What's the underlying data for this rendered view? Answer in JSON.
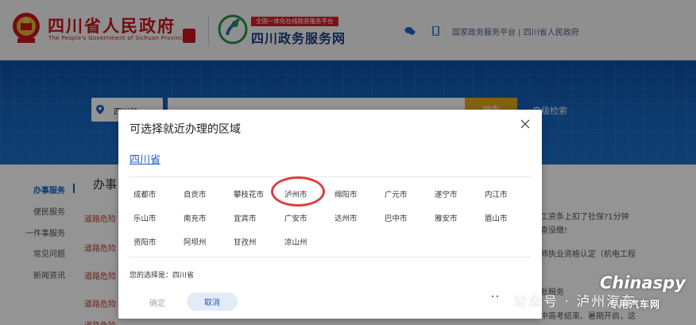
{
  "header": {
    "gov_title": "四川省人民政府",
    "gov_subtitle": "The People's Government of Sichuan Province",
    "svc_tag": "全国一体化在线政务服务平台",
    "svc_title": "四川政务服务网",
    "links": "国家政务服务平台 | 四川省人民政府",
    "icons": [
      "wechat-icon",
      "mobile-icon"
    ]
  },
  "banner": {
    "region_value": "四川省",
    "search_placeholder": "",
    "search_button": "搜索",
    "advanced_search": "高级检索"
  },
  "left_nav": {
    "items": [
      {
        "label": "办事服务",
        "active": true
      },
      {
        "label": "便民服务"
      },
      {
        "label": "一件事服务"
      },
      {
        "label": "常见问题"
      },
      {
        "label": "新闻资讯"
      }
    ]
  },
  "main": {
    "title": "办事",
    "list": [
      "道路危险",
      "道路危险",
      "道路危险",
      "道路危险",
      "道路危险"
    ],
    "right_snippets": [
      "工资条上扣了社保?1分钟",
      "查没缴!",
      "师执业资格认定（机电工程",
      "批服务",
      "中高考结束、暑期开启，这"
    ]
  },
  "modal": {
    "title": "可选择就近办理的区域",
    "province": "四川省",
    "cities": [
      "成都市",
      "自贡市",
      "攀枝花市",
      "泸州市",
      "绵阳市",
      "广元市",
      "遂宁市",
      "内江市",
      "乐山市",
      "南充市",
      "宜宾市",
      "广安市",
      "达州市",
      "巴中市",
      "雅安市",
      "眉山市",
      "资阳市",
      "阿坝州",
      "甘孜州",
      "凉山州"
    ],
    "selected_city": "泸州市",
    "choice_label": "您的选择是：四川省",
    "ok_label": "确定",
    "cancel_label": "取消"
  },
  "watermark": {
    "text": "公众号 · 泸州汽车",
    "brand": "Chinaspy",
    "brand_sub": "专用汽车网"
  },
  "colors": {
    "gov_red": "#c8161d",
    "link_blue": "#1c5fc1",
    "banner_blue": "#1566bf",
    "search_orange": "#e8a71c",
    "highlight_red": "#e03a3a"
  }
}
